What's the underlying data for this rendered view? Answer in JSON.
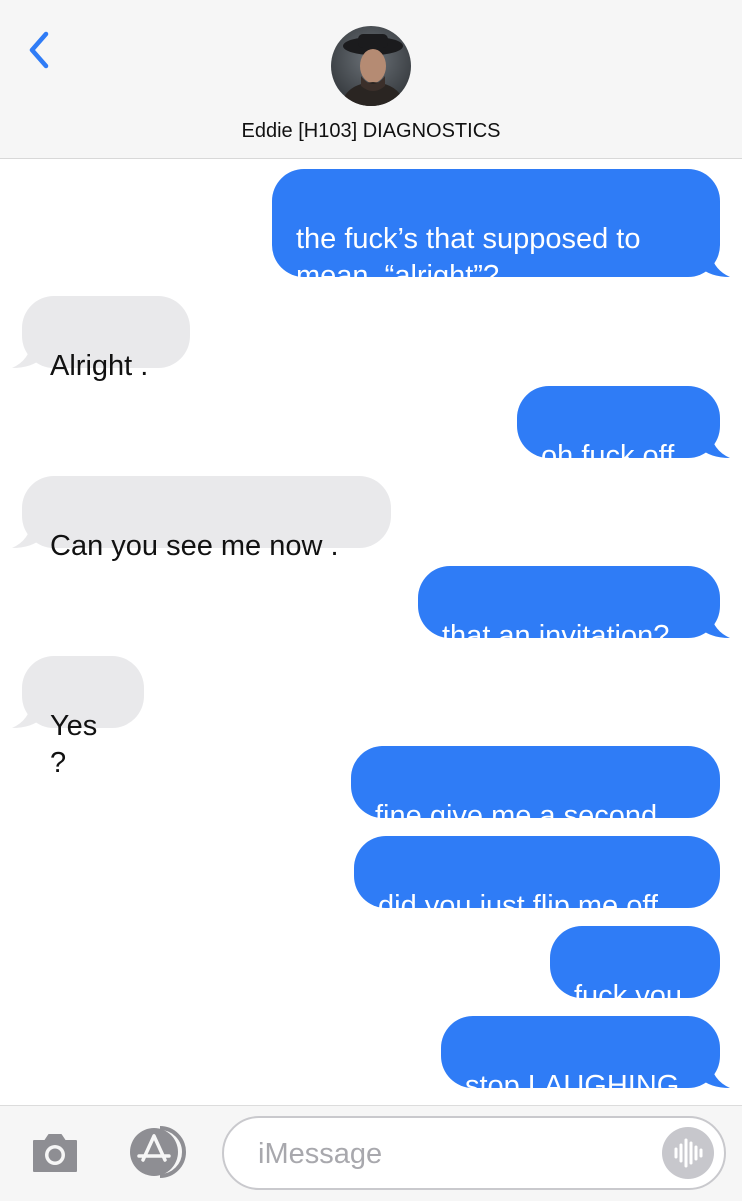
{
  "header": {
    "contact_name": "Eddie [H103] DIAGNOSTICS",
    "back_icon": "chevron-left-icon"
  },
  "messages": [
    {
      "side": "sent",
      "text": "the fuck’s that supposed to\nmean, “alright”?"
    },
    {
      "side": "received",
      "text": "Alright ."
    },
    {
      "side": "sent",
      "text": "oh fuck off"
    },
    {
      "side": "received",
      "text": "Can you see me now ."
    },
    {
      "side": "sent",
      "text": "that an invitation?"
    },
    {
      "side": "received",
      "text": "Yes ?"
    },
    {
      "side": "sent",
      "text": "fine give me a second"
    },
    {
      "side": "sent",
      "text": "did you just flip me off"
    },
    {
      "side": "sent",
      "text": "fuck you"
    },
    {
      "side": "sent",
      "text": "stop LAUGHING"
    }
  ],
  "composer": {
    "placeholder": "iMessage",
    "camera_icon": "camera-icon",
    "apps_icon": "app-store-icon",
    "mic_icon": "audio-waveform-icon"
  },
  "colors": {
    "sent_bubble": "#2f7cf6",
    "received_bubble": "#e9e9eb",
    "accent": "#2f7cf6"
  }
}
